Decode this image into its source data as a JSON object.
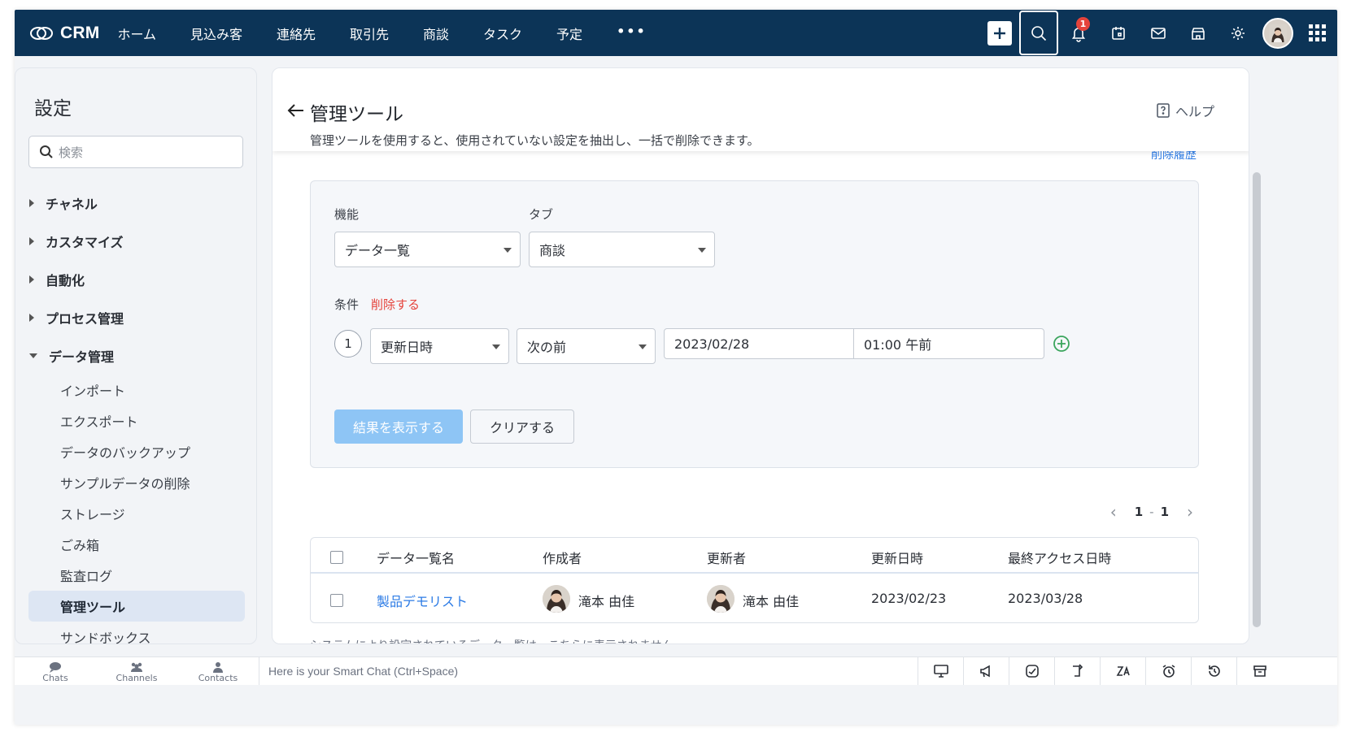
{
  "brand": {
    "name": "CRM"
  },
  "nav": [
    "ホーム",
    "見込み客",
    "連絡先",
    "取引先",
    "商談",
    "タスク",
    "予定",
    "•••"
  ],
  "notifications": {
    "count": "1"
  },
  "settings": {
    "title": "設定",
    "search_placeholder": "検索",
    "groups": [
      {
        "label": "チャネル"
      },
      {
        "label": "カスタマイズ"
      },
      {
        "label": "自動化"
      },
      {
        "label": "プロセス管理"
      },
      {
        "label": "データ管理"
      }
    ],
    "data_items": [
      {
        "label": "インポート"
      },
      {
        "label": "エクスポート"
      },
      {
        "label": "データのバックアップ"
      },
      {
        "label": "サンプルデータの削除"
      },
      {
        "label": "ストレージ"
      },
      {
        "label": "ごみ箱"
      },
      {
        "label": "監査ログ"
      },
      {
        "label": "管理ツール",
        "active": true
      },
      {
        "label": "サンドボックス"
      }
    ]
  },
  "page": {
    "title": "管理ツール",
    "description": "管理ツールを使用すると、使用されていない設定を抽出し、一括で削除できます。",
    "help": "ヘルプ",
    "history_link": "削除履歴"
  },
  "filter": {
    "feature_label": "機能",
    "feature_value": "データ一覧",
    "tab_label": "タブ",
    "tab_value": "商談",
    "condition_label": "条件",
    "delete_label": "削除する",
    "condition_no": "1",
    "field_value": "更新日時",
    "operator_value": "次の前",
    "date_value": "2023/02/28",
    "time_value": "01:00 午前",
    "show_results": "結果を表示する",
    "clear": "クリアする"
  },
  "pagination": {
    "from": "1",
    "sep": "-",
    "to": "1"
  },
  "table": {
    "columns": [
      "データ一覧名",
      "作成者",
      "更新者",
      "更新日時",
      "最終アクセス日時"
    ],
    "rows": [
      {
        "name": "製品デモリスト",
        "creator": "滝本 由佳",
        "updater": "滝本 由佳",
        "updated": "2023/02/23",
        "accessed": "2023/03/28"
      }
    ]
  },
  "bottom_note": "システムにより設定されているデータ一覧は、こちらに表示されません。",
  "chatbar": {
    "tabs": [
      "Chats",
      "Channels",
      "Contacts"
    ],
    "placeholder": "Here is your Smart Chat (Ctrl+Space)"
  },
  "colors": {
    "topbar": "#0c3457",
    "accent": "#2c7be5",
    "danger": "#e5433b",
    "add": "#3ba55d"
  }
}
